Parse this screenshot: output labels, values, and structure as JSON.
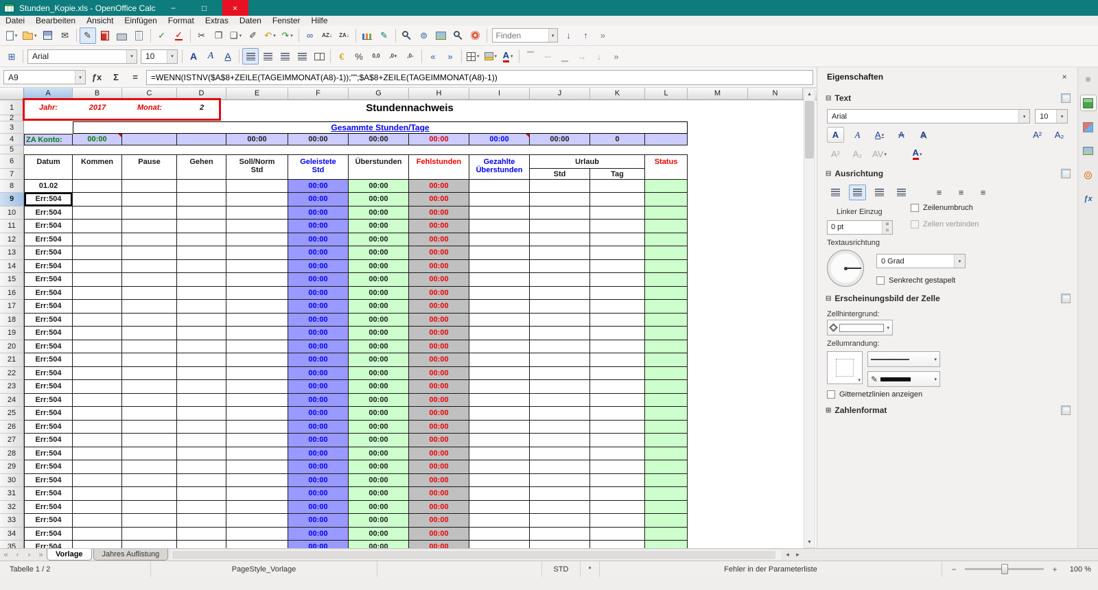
{
  "window": {
    "title": "Stunden_Kopie.xls - OpenOffice Calc",
    "controls": [
      {
        "n": "minimize-button",
        "g": "−"
      },
      {
        "n": "maximize-button",
        "g": "□"
      },
      {
        "n": "close-button",
        "g": "×",
        "cls": "wbtn close"
      }
    ]
  },
  "colors": {
    "titlebar": "#0E7C7C",
    "annotation_red": "#E30613",
    "lavender_band": "#CCCCFF",
    "worked_hours_purple": "#9999FF",
    "overtime_mint": "#CCFFCC",
    "missing_hours_gray": "#C0C0C0",
    "status_green": "#CCFFCC",
    "error_text_red": "#EE0000"
  },
  "menu": {
    "items": [
      {
        "label": "Datei",
        "name": "menu-datei"
      },
      {
        "label": "Bearbeiten",
        "name": "menu-bearbeiten"
      },
      {
        "label": "Ansicht",
        "name": "menu-ansicht"
      },
      {
        "label": "Einfügen",
        "name": "menu-einfuegen"
      },
      {
        "label": "Format",
        "name": "menu-format"
      },
      {
        "label": "Extras",
        "name": "menu-extras"
      },
      {
        "label": "Daten",
        "name": "menu-daten"
      },
      {
        "label": "Fenster",
        "name": "menu-fenster"
      },
      {
        "label": "Hilfe",
        "name": "menu-hilfe"
      }
    ]
  },
  "toolbar_standard": {
    "find_placeholder": "Finden",
    "items": [
      {
        "n": "new-document-icon",
        "cls": "g i-doc",
        "dd": true
      },
      {
        "n": "open-folder-icon",
        "cls": "g i-folder",
        "dd": true
      },
      {
        "n": "save-icon",
        "cls": "g i-save"
      },
      {
        "n": "email-icon",
        "g": "✉"
      },
      {
        "sep": true
      },
      {
        "n": "edit-mode-icon",
        "g": "✎",
        "active": true
      },
      {
        "n": "pdf-export-icon",
        "cls": "g i-pdf"
      },
      {
        "n": "print-icon",
        "cls": "g i-print"
      },
      {
        "n": "page-preview-icon",
        "cls": "g i-preview"
      },
      {
        "sep": true
      },
      {
        "n": "spellcheck-icon",
        "g": "✓",
        "cls": "g c-green"
      },
      {
        "n": "autospellcheck-icon",
        "g": "✓",
        "cls": "g c-red u-red"
      },
      {
        "sep": true
      },
      {
        "n": "cut-icon",
        "g": "✂"
      },
      {
        "n": "copy-icon",
        "g": "❐"
      },
      {
        "n": "paste-icon",
        "g": "❑",
        "dd": true
      },
      {
        "n": "format-paintbrush-icon",
        "g": "✐"
      },
      {
        "n": "undo-icon",
        "g": "↶",
        "cls": "g c-gold",
        "dd": true
      },
      {
        "n": "redo-icon",
        "g": "↷",
        "cls": "g c-green",
        "dd": true
      },
      {
        "sep": true
      },
      {
        "n": "hyperlink-icon",
        "g": "∞",
        "cls": "g c-blue"
      },
      {
        "n": "sort-ascending-icon",
        "g": "AZ↓",
        "cls": "g i-small"
      },
      {
        "n": "sort-descending-icon",
        "g": "ZA↓",
        "cls": "g i-small"
      },
      {
        "sep": true
      },
      {
        "n": "chart-icon",
        "cls": "g i-chart"
      },
      {
        "n": "draw-functions-icon",
        "g": "✎",
        "cls": "g c-teal"
      },
      {
        "sep": true
      },
      {
        "n": "find-replace-icon",
        "cls": "g i-mag"
      },
      {
        "n": "navigator-icon",
        "g": "⊚",
        "cls": "g c-blue"
      },
      {
        "n": "gallery-icon",
        "cls": "g i-pic"
      },
      {
        "n": "zoom-icon",
        "cls": "g i-mag"
      },
      {
        "n": "help-icon",
        "cls": "g i-help"
      },
      {
        "sep": true
      }
    ]
  },
  "toolbar_formatting": {
    "font_name": "Arial",
    "font_size": "10",
    "items": [
      {
        "n": "bold-icon",
        "g": "A",
        "cls": "g fmt-b"
      },
      {
        "n": "italic-icon",
        "g": "A",
        "cls": "g fmt-i"
      },
      {
        "n": "underline-icon",
        "g": "A",
        "cls": "g fmt-u"
      },
      {
        "sep": true
      },
      {
        "n": "align-left-icon",
        "cls": "g i-al",
        "active": true
      },
      {
        "n": "align-center-icon",
        "cls": "g i-al"
      },
      {
        "n": "align-right-icon",
        "cls": "g i-al"
      },
      {
        "n": "align-justify-icon",
        "cls": "g i-al"
      },
      {
        "n": "merge-cells-icon",
        "cls": "g i-merge"
      },
      {
        "sep": true
      },
      {
        "n": "currency-format-icon",
        "g": "€",
        "cls": "g c-gold"
      },
      {
        "n": "percent-format-icon",
        "g": "%"
      },
      {
        "n": "standard-format-icon",
        "g": "0,0",
        "cls": "g i-small"
      },
      {
        "n": "add-decimal-icon",
        "g": ",0+",
        "cls": "g i-small"
      },
      {
        "n": "delete-decimal-icon",
        "g": ",0-",
        "cls": "g i-small"
      },
      {
        "sep": true
      },
      {
        "n": "decrease-indent-icon",
        "g": "«",
        "cls": "g c-blue"
      },
      {
        "n": "increase-indent-icon",
        "g": "»",
        "cls": "g c-blue"
      },
      {
        "sep": true
      },
      {
        "n": "borders-icon",
        "cls": "g i-borders",
        "dd": true
      },
      {
        "n": "background-color-icon",
        "cls": "g i-bgcolor",
        "dd": true
      },
      {
        "n": "font-color-icon",
        "g": "A",
        "cls": "g i-fontcolor",
        "dd": true
      },
      {
        "sep": true
      },
      {
        "n": "align-top-icon",
        "g": "▔",
        "cls": "g dis"
      },
      {
        "n": "center-vertical-icon",
        "g": "─",
        "cls": "g dis"
      },
      {
        "n": "align-bottom-icon",
        "g": "▁",
        "cls": "g dis"
      },
      {
        "n": "text-ltr-icon",
        "g": "→",
        "cls": "g dis"
      },
      {
        "n": "text-ttb-icon",
        "g": "↓",
        "cls": "g dis"
      }
    ]
  },
  "formula_bar": {
    "cell_reference": "A9",
    "formula": "=WENN(ISTNV($A$8+ZEILE(TAGEIMMONAT(A8)-1));\"\";$A$8+ZEILE(TAGEIMMONAT(A8)-1))",
    "buttons": [
      {
        "n": "function-wizard-icon",
        "g": "ƒx"
      },
      {
        "n": "sum-icon",
        "g": "Σ"
      },
      {
        "n": "equals-icon",
        "g": "="
      }
    ]
  },
  "sheet": {
    "selected_cell": "A9",
    "columns": [
      {
        "l": "A",
        "cls": "ch wA",
        "sel": true,
        "name": "column-header-a"
      },
      {
        "l": "B",
        "cls": "ch wB",
        "name": "column-header-b"
      },
      {
        "l": "C",
        "cls": "ch wC",
        "name": "column-header-c"
      },
      {
        "l": "D",
        "cls": "ch wD",
        "name": "column-header-d"
      },
      {
        "l": "E",
        "cls": "ch wE",
        "name": "column-header-e"
      },
      {
        "l": "F",
        "cls": "ch wF",
        "name": "column-header-f"
      },
      {
        "l": "G",
        "cls": "ch wG",
        "name": "column-header-g"
      },
      {
        "l": "H",
        "cls": "ch wH",
        "name": "column-header-h"
      },
      {
        "l": "I",
        "cls": "ch wI",
        "name": "column-header-i"
      },
      {
        "l": "J",
        "cls": "ch wJ",
        "name": "column-header-j"
      },
      {
        "l": "K",
        "cls": "ch wK",
        "name": "column-header-k"
      },
      {
        "l": "L",
        "cls": "ch wL",
        "name": "column-header-l"
      },
      {
        "l": "M",
        "cls": "ch wJ",
        "name": "column-header-m"
      },
      {
        "l": "N",
        "cls": "ch wK",
        "name": "column-header-n"
      }
    ],
    "rownums": [
      "1",
      "2",
      "3",
      "4",
      "5",
      "6",
      "7",
      "8"
    ],
    "row1": {
      "jahr_label": "Jahr:",
      "jahr_value": "2017",
      "monat_label": "Monat:",
      "monat_value": "2",
      "title": "Stundennachweis"
    },
    "row3": {
      "banner": "Gesammte Stunden/Tage"
    },
    "row4": {
      "za_label": "ZA Konto:",
      "za_value": "00:00",
      "e": "00:00",
      "f": "00:00",
      "g": "00:00",
      "h": "00:00",
      "i": "00:00",
      "j": "00:00",
      "k": "0"
    },
    "header": {
      "datum": "Datum",
      "kommen": "Kommen",
      "pause": "Pause",
      "gehen": "Gehen",
      "soll1": "Soll/Norm",
      "soll2": "Std",
      "geleistete1": "Geleistete",
      "geleistete2": "Std",
      "ueberstunden": "Überstunden",
      "fehlstunden": "Fehlstunden",
      "gezahlte1": "Gezahlte",
      "gezahlte2": "Überstunden",
      "urlaub": "Urlaub",
      "std": "Std",
      "tag": "Tag",
      "status": "Status"
    },
    "row8": {
      "date": "01.02"
    },
    "err_value": "Err:504",
    "time_value": "00:00",
    "err_rows": [
      {
        "n": "9",
        "sel": true
      },
      {
        "n": "10"
      },
      {
        "n": "11"
      },
      {
        "n": "12"
      },
      {
        "n": "13"
      },
      {
        "n": "14"
      },
      {
        "n": "15"
      },
      {
        "n": "16"
      },
      {
        "n": "17"
      },
      {
        "n": "18"
      },
      {
        "n": "19"
      },
      {
        "n": "20"
      },
      {
        "n": "21"
      },
      {
        "n": "22"
      },
      {
        "n": "23"
      },
      {
        "n": "24"
      },
      {
        "n": "25"
      },
      {
        "n": "26"
      },
      {
        "n": "27"
      },
      {
        "n": "28"
      },
      {
        "n": "29"
      },
      {
        "n": "30"
      },
      {
        "n": "31"
      },
      {
        "n": "32"
      },
      {
        "n": "33"
      },
      {
        "n": "34"
      },
      {
        "n": "35"
      }
    ]
  },
  "sidebar": {
    "title": "Eigenschaften",
    "sections": {
      "text": "Text",
      "alignment": "Ausrichtung",
      "cell_appearance": "Erscheinungsbild der Zelle",
      "number_format": "Zahlenformat"
    },
    "font_name": "Arial",
    "font_size": "10",
    "left_indent_label": "Linker Einzug",
    "indent_value": "0 pt",
    "wrap_label": "Zeilenumbruch",
    "merge_label": "Zellen verbinden",
    "orientation_label": "Textausrichtung",
    "degrees_value": "0 Grad",
    "stacked_label": "Senkrecht gestapelt",
    "background_label": "Zellhintergrund:",
    "border_label": "Zellumrandung:",
    "gridlines_label": "Gitternetzlinien anzeigen",
    "glyphs": {
      "close": "×",
      "collapse": "⊟",
      "expand": "⊞",
      "down": "▾",
      "letter_a": "A",
      "sup": "A²",
      "sub": "A₂",
      "spacing": "AV",
      "pen": "✎",
      "lines": "≡"
    },
    "tabs": [
      {
        "n": "sidebar-menu-icon",
        "g": "≡",
        "cls": "g sdim"
      },
      {
        "n": "properties-tab-icon",
        "cls": "g i-props",
        "active": true
      },
      {
        "n": "styles-tab-icon",
        "cls": "g i-styles"
      },
      {
        "n": "gallery-tab-icon",
        "cls": "g i-pic"
      },
      {
        "n": "navigator-tab-icon",
        "g": "⊚",
        "cls": "g c-orange big"
      },
      {
        "n": "functions-tab-icon",
        "g": "ƒx",
        "cls": "g i-fx"
      }
    ]
  },
  "tabs": {
    "nav": [
      {
        "n": "first-sheet-button",
        "g": "«"
      },
      {
        "n": "previous-sheet-button",
        "g": "‹"
      },
      {
        "n": "next-sheet-button",
        "g": "›"
      },
      {
        "n": "last-sheet-button",
        "g": "»"
      }
    ],
    "items": [
      {
        "label": "Vorlage",
        "active": true,
        "name": "sheet-tab-vorlage"
      },
      {
        "label": "Jahres Auflistung",
        "name": "sheet-tab-jahres-auflistung"
      }
    ],
    "scroll_left": "◂",
    "scroll_right": "▸"
  },
  "statusbar": {
    "sheet_info": "Tabelle 1 / 2",
    "page_style": "PageStyle_Vorlage",
    "insert_mode": "STD",
    "modified_flag": "*",
    "message": "Fehler in der Parameterliste",
    "zoom_out": "−",
    "zoom_in": "+",
    "zoom_level": "100 %"
  },
  "ui": {
    "down": "▾",
    "up": "▴",
    "scroll_up": "▲",
    "scroll_down": "▼",
    "chevron": "»",
    "find_next": "↓",
    "find_prev": "↑",
    "grid": "⊞"
  }
}
